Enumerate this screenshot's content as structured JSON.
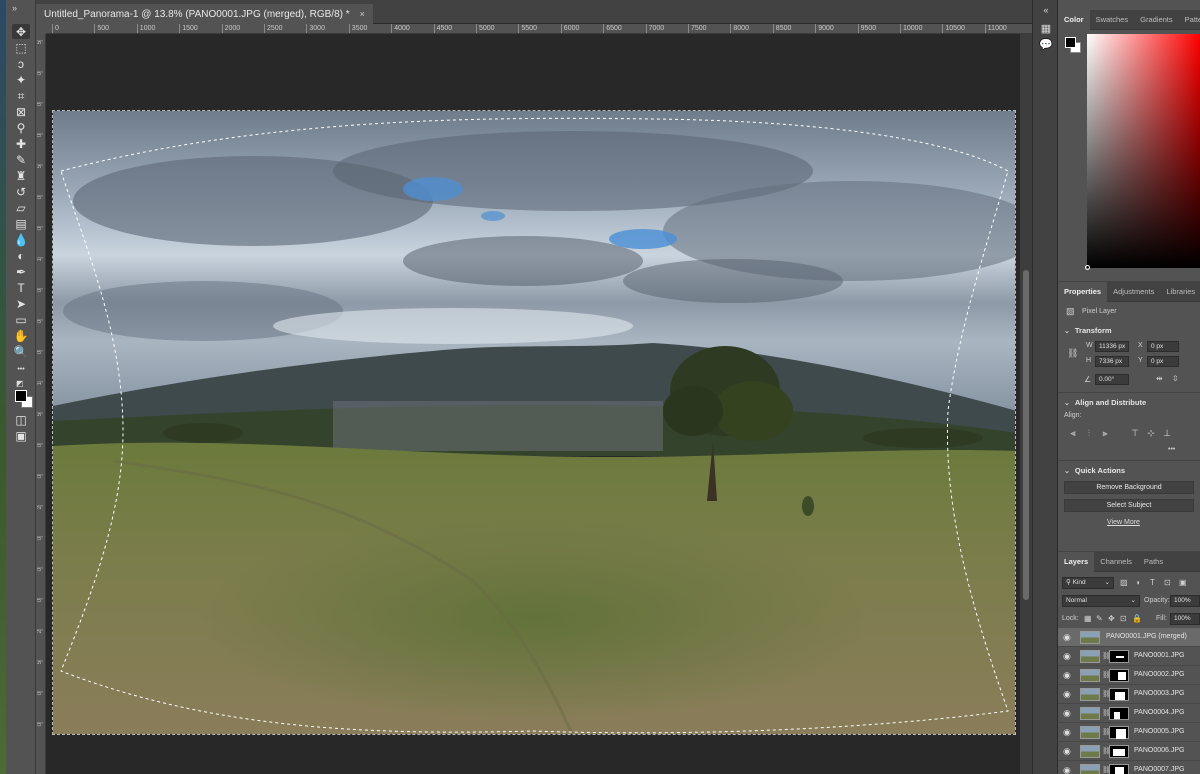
{
  "document": {
    "tab_title": "Untitled_Panorama-1 @ 13.8% (PANO0001.JPG (merged), RGB/8) *",
    "tab_close": "×"
  },
  "ruler": {
    "top_labels": [
      "0",
      "500",
      "1000",
      "1500",
      "2000",
      "2500",
      "3000",
      "3500",
      "4000",
      "4500",
      "5000",
      "5500",
      "6000",
      "6500",
      "7000",
      "7500",
      "8000",
      "8500",
      "9000",
      "9500",
      "10000",
      "10500",
      "11000"
    ],
    "left_labels": [
      "5",
      "0",
      "0",
      "0",
      "5",
      "0",
      "0",
      "1",
      "0",
      "0",
      "0",
      "1",
      "5",
      "0",
      "0",
      "2",
      "0",
      "0",
      "0",
      "2",
      "5",
      "0",
      "0"
    ]
  },
  "toolbar": {
    "collapse": "»",
    "tools": [
      {
        "name": "move-tool-icon",
        "glyph": "✥"
      },
      {
        "name": "marquee-tool-icon",
        "glyph": "⬚"
      },
      {
        "name": "lasso-tool-icon",
        "glyph": "ↄ"
      },
      {
        "name": "magic-wand-tool-icon",
        "glyph": "✦"
      },
      {
        "name": "crop-tool-icon",
        "glyph": "⌗"
      },
      {
        "name": "frame-tool-icon",
        "glyph": "⊠"
      },
      {
        "name": "eyedropper-tool-icon",
        "glyph": "⚲"
      },
      {
        "name": "healing-brush-tool-icon",
        "glyph": "✚"
      },
      {
        "name": "brush-tool-icon",
        "glyph": "✎"
      },
      {
        "name": "clone-stamp-tool-icon",
        "glyph": "♜"
      },
      {
        "name": "history-brush-tool-icon",
        "glyph": "↺"
      },
      {
        "name": "eraser-tool-icon",
        "glyph": "▱"
      },
      {
        "name": "gradient-tool-icon",
        "glyph": "▤"
      },
      {
        "name": "blur-tool-icon",
        "glyph": "💧"
      },
      {
        "name": "dodge-tool-icon",
        "glyph": "◐"
      },
      {
        "name": "pen-tool-icon",
        "glyph": "✒"
      },
      {
        "name": "type-tool-icon",
        "glyph": "T"
      },
      {
        "name": "path-selection-tool-icon",
        "glyph": "➤"
      },
      {
        "name": "rectangle-tool-icon",
        "glyph": "▭"
      },
      {
        "name": "hand-tool-icon",
        "glyph": "✋"
      },
      {
        "name": "zoom-tool-icon",
        "glyph": "🔍"
      },
      {
        "name": "more-tools-icon",
        "glyph": "•••"
      }
    ],
    "quick_mask_glyph": "◫",
    "screen_mode_glyph": "▣"
  },
  "icon_column": {
    "collapse": "«",
    "items": [
      {
        "name": "history-panel-icon",
        "glyph": "▦"
      },
      {
        "name": "comments-panel-icon",
        "glyph": "💬"
      }
    ]
  },
  "color_panel": {
    "tabs": [
      "Color",
      "Swatches",
      "Gradients",
      "Patterns"
    ],
    "active_tab": "Color"
  },
  "properties_panel": {
    "tabs": [
      "Properties",
      "Adjustments",
      "Libraries"
    ],
    "active_tab": "Properties",
    "layer_type": "Pixel Layer",
    "transform": {
      "heading": "Transform",
      "w_label": "W",
      "w_value": "11336 px",
      "x_label": "X",
      "x_value": "0 px",
      "h_label": "H",
      "h_value": "7336 px",
      "y_label": "Y",
      "y_value": "0 px",
      "angle_value": "0.00°"
    },
    "align": {
      "heading": "Align and Distribute",
      "label": "Align:",
      "more": "•••"
    },
    "quick_actions": {
      "heading": "Quick Actions",
      "remove_background": "Remove Background",
      "select_subject": "Select Subject",
      "view_more": "View More"
    }
  },
  "layers_panel": {
    "tabs": [
      "Layers",
      "Channels",
      "Paths"
    ],
    "active_tab": "Layers",
    "filter_kind": "Kind",
    "blend_mode": "Normal",
    "opacity_label": "Opacity:",
    "opacity_value": "100%",
    "lock_label": "Lock:",
    "fill_label": "Fill:",
    "fill_value": "100%",
    "layers": [
      {
        "name": "PANO0001.JPG (merged)",
        "selected": true,
        "has_mask": false
      },
      {
        "name": "PANO0001.JPG",
        "selected": false,
        "has_mask": true
      },
      {
        "name": "PANO0002.JPG",
        "selected": false,
        "has_mask": true
      },
      {
        "name": "PANO0003.JPG",
        "selected": false,
        "has_mask": true
      },
      {
        "name": "PANO0004.JPG",
        "selected": false,
        "has_mask": true
      },
      {
        "name": "PANO0005.JPG",
        "selected": false,
        "has_mask": true
      },
      {
        "name": "PANO0006.JPG",
        "selected": false,
        "has_mask": true
      },
      {
        "name": "PANO0007.JPG",
        "selected": false,
        "has_mask": true
      }
    ]
  },
  "colors": {
    "panel_bg": "#535353",
    "dark_bg": "#282828",
    "selected_layer": "#6a6a6a"
  }
}
